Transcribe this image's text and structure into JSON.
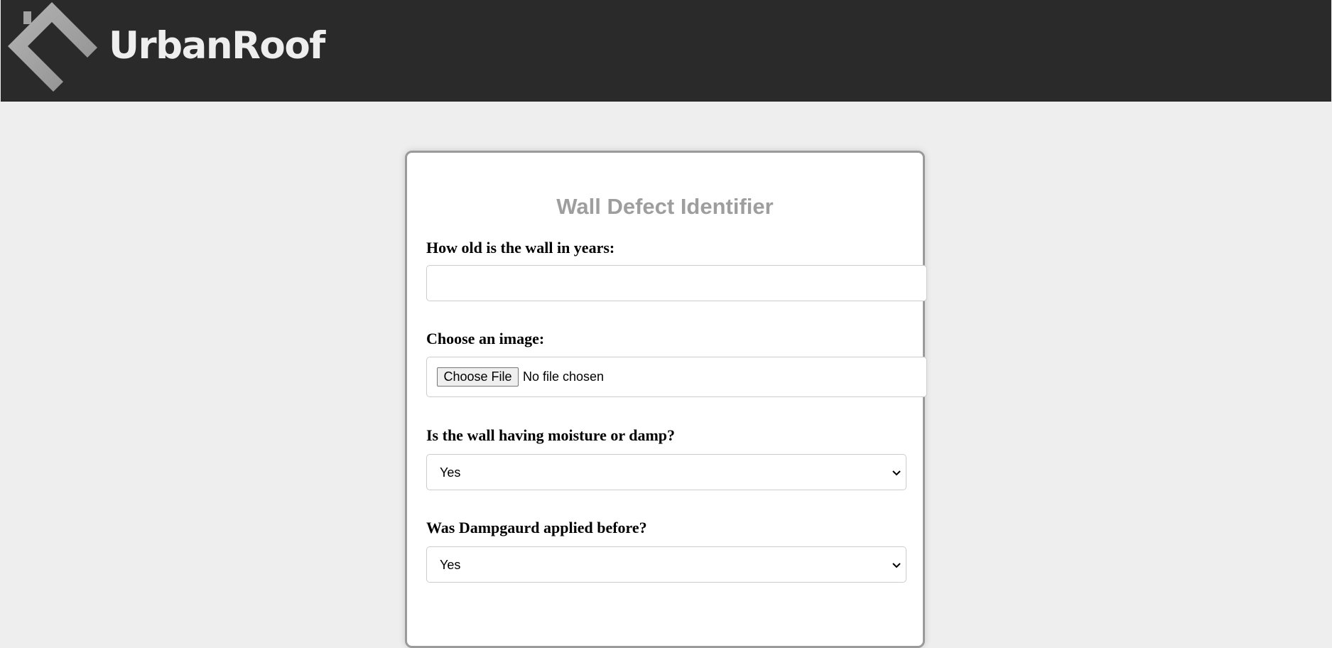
{
  "header": {
    "logo_icon": "house-roof-icon",
    "brand_name": "UrbanRoof",
    "background_color": "#2a2a2a"
  },
  "form": {
    "title": "Wall Defect Identifier",
    "title_color": "#9e9e9e",
    "age_label": "How old is the wall in years:",
    "age_value": "",
    "image_label": "Choose an image:",
    "file_button_label": "Choose File",
    "file_status": "No file chosen",
    "moisture_label": "Is the wall having moisture or damp?",
    "moisture_value": "Yes",
    "dampguard_label": "Was Dampgaurd applied before?",
    "dampguard_value": "Yes"
  },
  "icons": {
    "dropdown": "chevron-down-icon"
  },
  "colors": {
    "page_background": "#eeeeee",
    "card_border": "#9a9a9a"
  }
}
